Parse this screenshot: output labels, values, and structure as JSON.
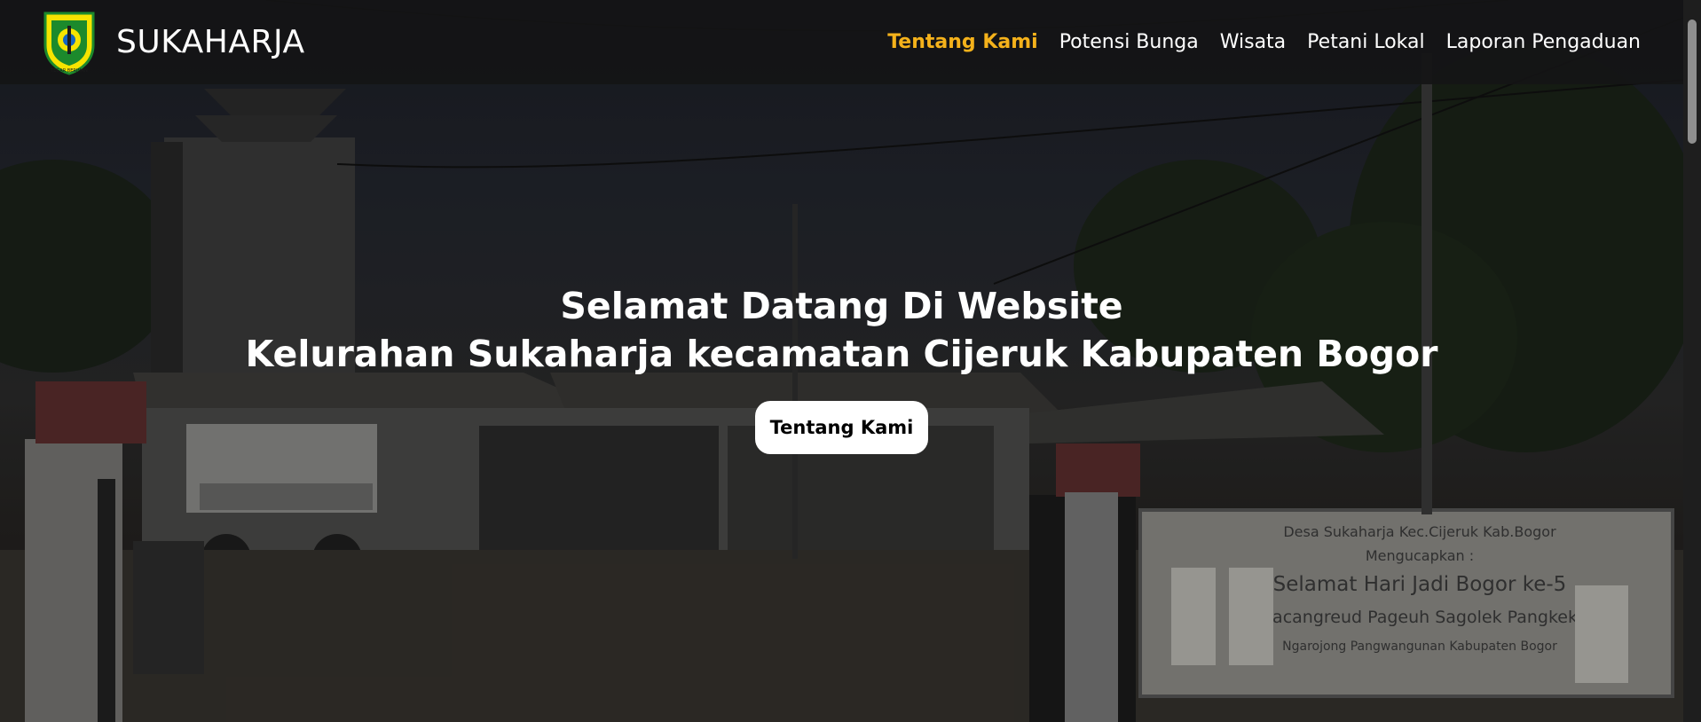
{
  "brand": {
    "name": "SUKAHARJA",
    "logo_icon": "bogor-regency-emblem-icon",
    "logo_motto": "TEGAR BERIMAN"
  },
  "nav": {
    "items": [
      {
        "label": "Tentang Kami",
        "active": true
      },
      {
        "label": "Potensi Bunga",
        "active": false
      },
      {
        "label": "Wisata",
        "active": false
      },
      {
        "label": "Petani Lokal",
        "active": false
      },
      {
        "label": "Laporan Pengaduan",
        "active": false
      }
    ]
  },
  "hero": {
    "title_line1": "Selamat Datang Di Website",
    "title_line2": "Kelurahan Sukaharja kecamatan Cijeruk Kabupaten Bogor",
    "button_label": "Tentang Kami",
    "banner_lines": [
      "Desa Sukaharja Kec.Cijeruk Kab.Bogor",
      "Mengucapkan :",
      "Selamat Hari Jadi Bogor ke-5",
      "Sacangreud Pageuh Sagolek Pangkek",
      "Ngarojong Pangwangunan Kabupaten Bogor"
    ]
  },
  "colors": {
    "accent": "#f5b21b",
    "navbar_bg": "#141416",
    "button_bg": "#ffffff",
    "text": "#ffffff"
  }
}
